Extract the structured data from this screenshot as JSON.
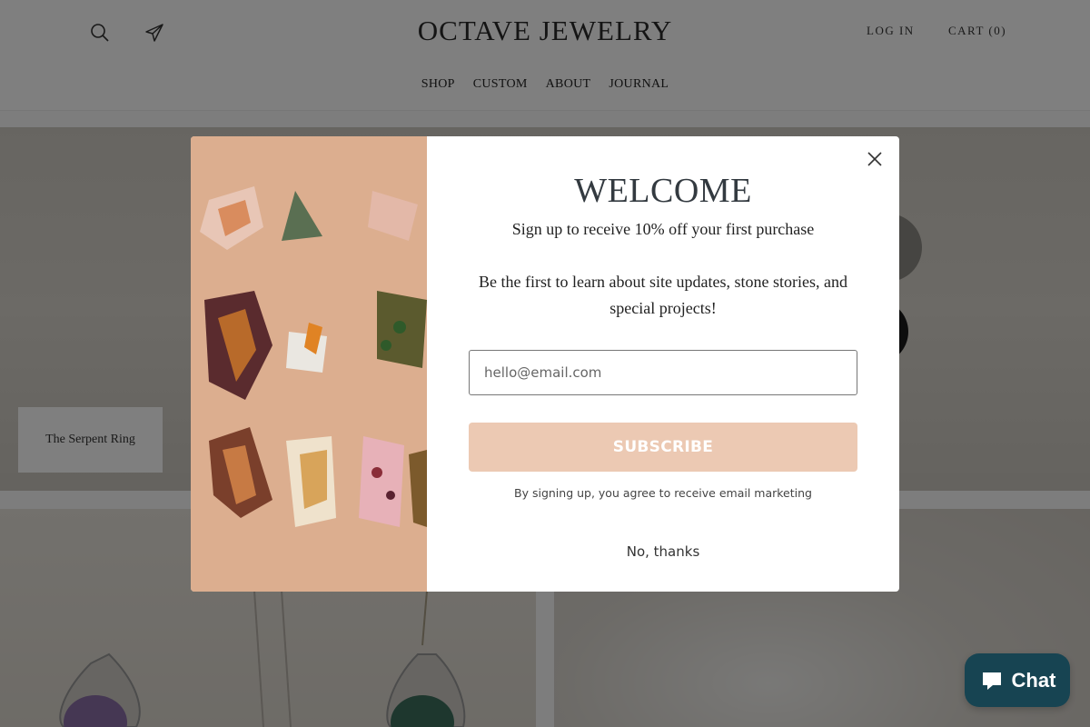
{
  "header": {
    "logo": "OCTAVE JEWELRY",
    "login": "LOG IN",
    "cart": "CART (0)",
    "icons": [
      "search-icon",
      "paper-plane-icon"
    ]
  },
  "nav": {
    "items": [
      "SHOP",
      "CUSTOM",
      "ABOUT",
      "JOURNAL"
    ]
  },
  "hero": {
    "caption": "The Serpent Ring"
  },
  "modal": {
    "title": "WELCOME",
    "subtitle": "Sign up to receive 10% off your first purchase",
    "description": "Be the first to learn about site updates, stone stories, and special projects!",
    "email_placeholder": "hello@email.com",
    "subscribe": "SUBSCRIBE",
    "legal": "By signing up, you agree to receive email marketing",
    "no_thanks": "No, thanks",
    "close_icon": "close-icon"
  },
  "chat": {
    "label": "Chat",
    "icon": "chat-bubble-icon"
  },
  "colors": {
    "overlay": "#000000",
    "subscribe_bg": "#ecc9b3",
    "chat_bg": "#174452",
    "image_bg": "#dcae8f"
  }
}
